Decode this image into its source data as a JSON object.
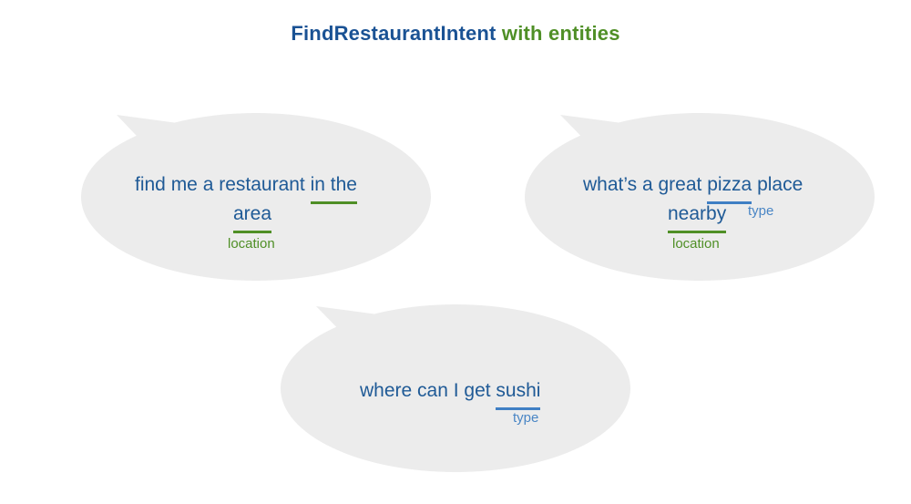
{
  "title": {
    "intent": "FindRestaurantIntent",
    "suffix": "with entities"
  },
  "colors": {
    "intent_blue": "#1a5294",
    "entity_green": "#4f8f26",
    "type_blue": "#3f7fc4",
    "bubble_gray": "#ececec",
    "utterance_text": "#1f5a96"
  },
  "utterances": [
    {
      "line1_pre": "find me a restaurant ",
      "line1_ent": "in the",
      "line2_ent": "area",
      "entity_label": "location"
    },
    {
      "line1_pre": "what’s a great ",
      "line1_ent": "pizza",
      "line1_post": " place",
      "line2_ent": "nearby",
      "type_label": "type",
      "location_label": "location"
    },
    {
      "line1_pre": "where can I get ",
      "line1_ent": "sushi",
      "type_label": "type"
    }
  ]
}
